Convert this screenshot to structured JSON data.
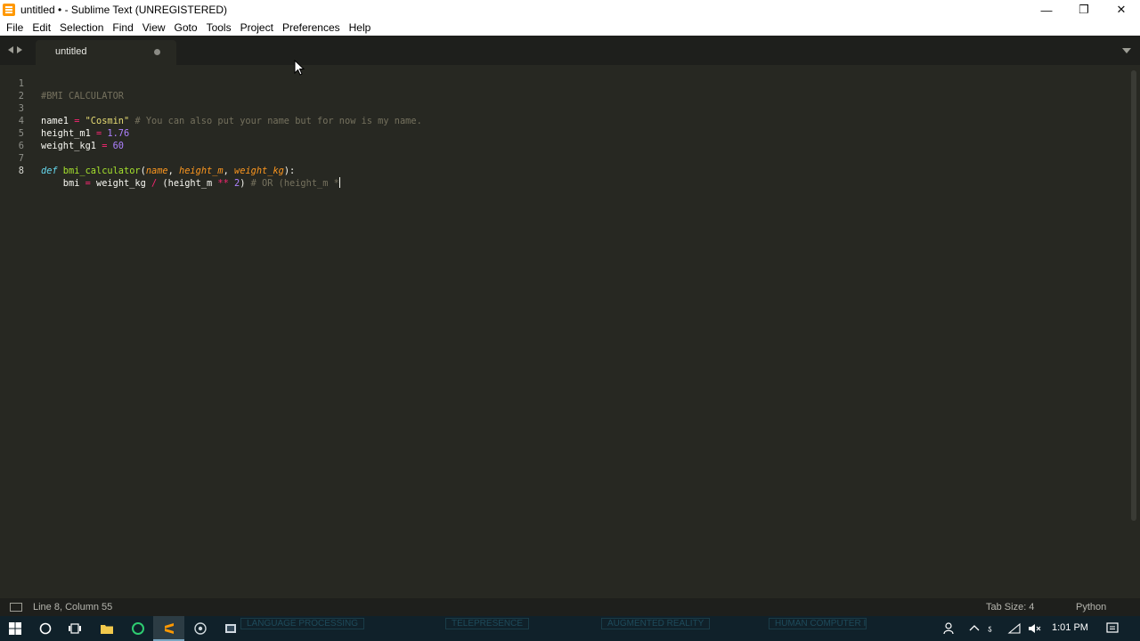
{
  "window": {
    "title": "untitled • - Sublime Text (UNREGISTERED)",
    "controls": {
      "minimize": "—",
      "restore": "❐",
      "close": "✕"
    }
  },
  "menu": [
    "File",
    "Edit",
    "Selection",
    "Find",
    "View",
    "Goto",
    "Tools",
    "Project",
    "Preferences",
    "Help"
  ],
  "tab": {
    "label": "untitled",
    "modified": true
  },
  "editor": {
    "line_numbers": [
      "1",
      "2",
      "3",
      "4",
      "5",
      "6",
      "7",
      "8"
    ],
    "active_line": 8,
    "lines": {
      "l1": "#BMI CALCULATOR",
      "l3_var": "name1",
      "l3_eq": " = ",
      "l3_str": "\"Cosmin\"",
      "l3_comment": " # You can also put your name but for now is my name.",
      "l4_var": "height_m1",
      "l4_eq": " = ",
      "l4_num": "1.76",
      "l5_var": "weight_kg1",
      "l5_eq": " = ",
      "l5_num": "60",
      "l7_def": "def",
      "l7_fn": " bmi_calculator",
      "l7_open": "(",
      "l7_p1": "name",
      "l7_sep1": ", ",
      "l7_p2": "height_m",
      "l7_sep2": ", ",
      "l7_p3": "weight_kg",
      "l7_close": "):",
      "l8_a": "    bmi",
      "l8_eq": " = ",
      "l8_b": "weight_kg ",
      "l8_div": "/",
      "l8_c": " (height_m ",
      "l8_pow": "**",
      "l8_sp": " ",
      "l8_two": "2",
      "l8_d": ")",
      "l8_comment": " # OR (height_m *"
    }
  },
  "status": {
    "position": "Line 8, Column 55",
    "tab_size": "Tab Size: 4",
    "syntax": "Python"
  },
  "taskbar": {
    "bg_labels": [
      "LANGUAGE PROCESSING",
      "TELEPRESENCE",
      "AUGMENTED REALITY",
      "HUMAN COMPUTER INTERACTION"
    ],
    "clock": "1:01 PM"
  },
  "colors": {
    "editor_bg": "#272822",
    "keyword": "#66d9ef",
    "function": "#a6e22e",
    "param": "#fd971f",
    "operator": "#f92672",
    "number": "#ae81ff",
    "string": "#e6db74",
    "comment": "#75715e"
  }
}
